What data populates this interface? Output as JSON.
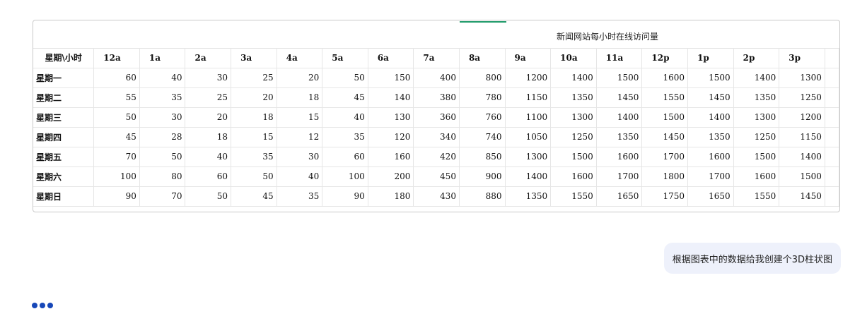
{
  "sheet": {
    "title": "新闻网站每小时在线访问量",
    "corner_label": "星期\\小时",
    "columns": [
      "12a",
      "1a",
      "2a",
      "3a",
      "4a",
      "5a",
      "6a",
      "7a",
      "8a",
      "9a",
      "10a",
      "11a",
      "12p",
      "1p",
      "2p",
      "3p"
    ],
    "rows": [
      {
        "label": "星期一",
        "values": [
          "60",
          "40",
          "30",
          "25",
          "20",
          "50",
          "150",
          "400",
          "800",
          "1200",
          "1400",
          "1500",
          "1600",
          "1500",
          "1400",
          "1300"
        ]
      },
      {
        "label": "星期二",
        "values": [
          "55",
          "35",
          "25",
          "20",
          "18",
          "45",
          "140",
          "380",
          "780",
          "1150",
          "1350",
          "1450",
          "1550",
          "1450",
          "1350",
          "1250"
        ]
      },
      {
        "label": "星期三",
        "values": [
          "50",
          "30",
          "20",
          "18",
          "15",
          "40",
          "130",
          "360",
          "760",
          "1100",
          "1300",
          "1400",
          "1500",
          "1400",
          "1300",
          "1200"
        ]
      },
      {
        "label": "星期四",
        "values": [
          "45",
          "28",
          "18",
          "15",
          "12",
          "35",
          "120",
          "340",
          "740",
          "1050",
          "1250",
          "1350",
          "1450",
          "1350",
          "1250",
          "1150"
        ]
      },
      {
        "label": "星期五",
        "values": [
          "70",
          "50",
          "40",
          "35",
          "30",
          "60",
          "160",
          "420",
          "850",
          "1300",
          "1500",
          "1600",
          "1700",
          "1600",
          "1500",
          "1400"
        ]
      },
      {
        "label": "星期六",
        "values": [
          "100",
          "80",
          "60",
          "50",
          "40",
          "100",
          "200",
          "450",
          "900",
          "1400",
          "1600",
          "1700",
          "1800",
          "1700",
          "1600",
          "1500"
        ]
      },
      {
        "label": "星期日",
        "values": [
          "90",
          "70",
          "50",
          "45",
          "35",
          "90",
          "180",
          "430",
          "880",
          "1350",
          "1550",
          "1650",
          "1750",
          "1650",
          "1550",
          "1450"
        ]
      }
    ]
  },
  "chat": {
    "user_message": "根据图表中的数据给我创建个3D柱状图"
  },
  "colors": {
    "accent_green": "#1f9a6a",
    "bubble_bg": "#eef1fb",
    "typing_dots": "#1747b8"
  },
  "icons": {
    "typing_indicator": "three-dots-loading-icon"
  }
}
